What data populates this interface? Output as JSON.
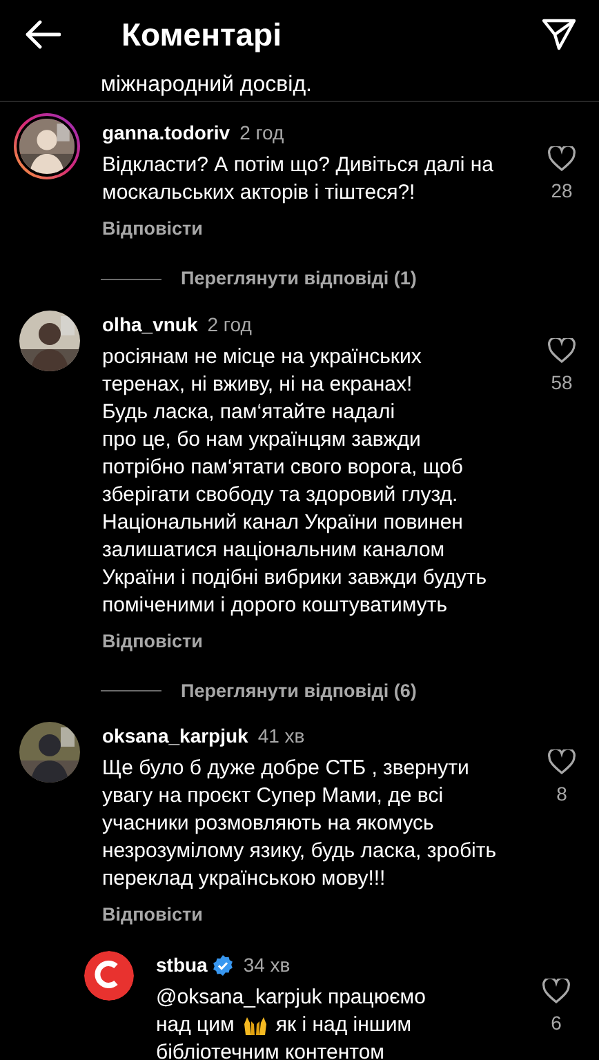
{
  "header": {
    "title": "Коментарі"
  },
  "clipped_text": "міжнародний досвід.",
  "comments": [
    {
      "username": "ganna.todoriv",
      "time": "2 год",
      "story_ring": true,
      "text": "Відкласти? А потім що? Дивіться далі на\nмоскальських акторів і тіштеся?!",
      "likes": "28",
      "reply_label": "Відповісти",
      "view_replies": "Переглянути відповіді (1)"
    },
    {
      "username": "olha_vnuk",
      "time": "2 год",
      "story_ring": false,
      "text": "росіянам не місце на українських\nтеренах, ні вживу, ні на екранах!\nБудь ласка, пам‘ятайте надалі\nпро це, бо нам українцям завжди\nпотрібно пам‘ятати свого ворога, щоб\nзберігати свободу та здоровий глузд.\nНаціональний канал України повинен\nзалишатися національним каналом\nУкраїни і подібні вибрики завжди будуть\nпоміченими і дорого коштуватимуть",
      "likes": "58",
      "reply_label": "Відповісти",
      "view_replies": "Переглянути відповіді (6)"
    },
    {
      "username": "oksana_karpjuk",
      "time": "41 хв",
      "story_ring": false,
      "text": "Ще було б дуже добре СТБ , звернути\nувагу на проєкт Супер Мами, де всі\nучасники розмовляють на якомусь\nнезрозумілому язику, будь ласка, зробіть\nпереклад українською мову!!!",
      "likes": "8",
      "reply_label": "Відповісти",
      "replies": [
        {
          "username": "stbua",
          "verified": true,
          "time": "34 хв",
          "text_lines": [
            {
              "text": "@oksana_karpjuk працюємо"
            },
            {
              "text_before_emoji": "над цим",
              "text_after_emoji": "як і над іншим"
            },
            {
              "text": "бібліотечним контентом"
            }
          ],
          "likes": "6"
        }
      ]
    }
  ]
}
